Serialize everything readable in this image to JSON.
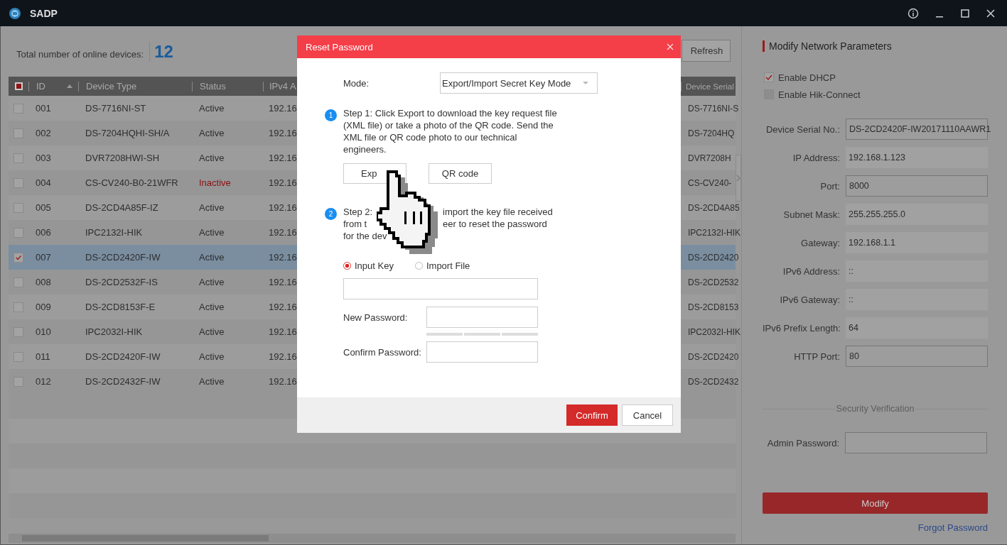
{
  "window": {
    "title": "SADP"
  },
  "summary": {
    "label": "Total number of online devices:",
    "count": "12"
  },
  "refresh_button": {
    "label": "Refresh"
  },
  "table": {
    "header_checkbox": {
      "indeterminate": true
    },
    "columns": [
      {
        "label": "ID",
        "sorted": true
      },
      {
        "label": "Device Type",
        "sorted": false
      },
      {
        "label": "Status",
        "sorted": false
      },
      {
        "label": "IPv4 A",
        "sorted": false
      },
      {
        "label": "Device Serial",
        "sorted": false
      }
    ],
    "rows": [
      {
        "id": "001",
        "device_type": "DS-7716NI-ST",
        "status": "Active",
        "kind": "active",
        "ipv4": "192.16",
        "serial": "DS-7716NI-S",
        "selected": false
      },
      {
        "id": "002",
        "device_type": "DS-7204HQHI-SH/A",
        "status": "Active",
        "kind": "active",
        "ipv4": "192.16",
        "serial": "DS-7204HQ",
        "selected": false
      },
      {
        "id": "003",
        "device_type": "DVR7208HWI-SH",
        "status": "Active",
        "kind": "active",
        "ipv4": "192.16",
        "serial": "DVR7208H",
        "selected": false
      },
      {
        "id": "004",
        "device_type": "CS-CV240-B0-21WFR",
        "status": "Inactive",
        "kind": "inactive",
        "ipv4": "192.16",
        "serial": "CS-CV240-",
        "selected": false
      },
      {
        "id": "005",
        "device_type": "DS-2CD4A85F-IZ",
        "status": "Active",
        "kind": "active",
        "ipv4": "192.16",
        "serial": "DS-2CD4A85",
        "selected": false
      },
      {
        "id": "006",
        "device_type": "IPC2132I-HIK",
        "status": "Active",
        "kind": "active",
        "ipv4": "192.16",
        "serial": "IPC2132I-HIK",
        "selected": false
      },
      {
        "id": "007",
        "device_type": "DS-2CD2420F-IW",
        "status": "Active",
        "kind": "active",
        "ipv4": "192.16",
        "serial": "DS-2CD2420",
        "selected": true
      },
      {
        "id": "008",
        "device_type": "DS-2CD2532F-IS",
        "status": "Active",
        "kind": "active",
        "ipv4": "192.16",
        "serial": "DS-2CD2532",
        "selected": false
      },
      {
        "id": "009",
        "device_type": "DS-2CD8153F-E",
        "status": "Active",
        "kind": "active",
        "ipv4": "192.16",
        "serial": "DS-2CD8153",
        "selected": false
      },
      {
        "id": "010",
        "device_type": "IPC2032I-HIK",
        "status": "Active",
        "kind": "active",
        "ipv4": "192.16",
        "serial": "IPC2032I-HIK",
        "selected": false
      },
      {
        "id": "011",
        "device_type": "DS-2CD2420F-IW",
        "status": "Active",
        "kind": "active",
        "ipv4": "192.16",
        "serial": "DS-2CD2420",
        "selected": false
      },
      {
        "id": "012",
        "device_type": "DS-2CD2432F-IW",
        "status": "Active",
        "kind": "active",
        "ipv4": "192.16",
        "serial": "DS-2CD2432",
        "selected": false
      }
    ]
  },
  "panel": {
    "title": "Modify Network Parameters",
    "checkboxes": [
      {
        "label": "Enable DHCP",
        "checked": true,
        "disabled": false
      },
      {
        "label": "Enable Hik-Connect",
        "checked": false,
        "disabled": true
      }
    ],
    "fields": [
      {
        "label": "Device Serial No.:",
        "value": "DS-2CD2420F-IW20171110AAWR1",
        "editable": true
      },
      {
        "label": "IP Address:",
        "value": "192.168.1.123",
        "editable": false
      },
      {
        "label": "Port:",
        "value": "8000",
        "editable": true
      },
      {
        "label": "Subnet Mask:",
        "value": "255.255.255.0",
        "editable": false
      },
      {
        "label": "Gateway:",
        "value": "192.168.1.1",
        "editable": false
      },
      {
        "label": "IPv6 Address:",
        "value": "::",
        "editable": false
      },
      {
        "label": "IPv6 Gateway:",
        "value": "::",
        "editable": false
      },
      {
        "label": "IPv6 Prefix Length:",
        "value": "64",
        "editable": false
      },
      {
        "label": "HTTP Port:",
        "value": "80",
        "editable": true
      }
    ],
    "section_title": "Security Verification",
    "admin_password": {
      "label": "Admin Password:"
    },
    "modify_button": {
      "label": "Modify"
    },
    "forgot_link": {
      "label": "Forgot Password"
    }
  },
  "dialog": {
    "title": "Reset Password",
    "mode": {
      "label": "Mode:",
      "value": "Export/Import Secret Key Mode"
    },
    "step1": {
      "number": "1",
      "text": "Step 1: Click Export to download the key request file (XML file) or take a photo of the QR code. Send the XML file or QR code photo to our technical engineers."
    },
    "export_button": {
      "label": "Exp"
    },
    "qr_button": {
      "label": "QR code"
    },
    "step2": {
      "number": "2",
      "lines": [
        [
          "Step 2:",
          "import the key file received"
        ],
        [
          "from t",
          "eer to reset the password"
        ],
        [
          "for the dev"
        ]
      ]
    },
    "radios": [
      {
        "label": "Input Key",
        "selected": true
      },
      {
        "label": "Import File",
        "selected": false
      }
    ],
    "new_password": {
      "label": "New Password:"
    },
    "confirm_password": {
      "label": "Confirm Password:"
    },
    "confirm_button": {
      "label": "Confirm"
    },
    "cancel_button": {
      "label": "Cancel"
    }
  }
}
